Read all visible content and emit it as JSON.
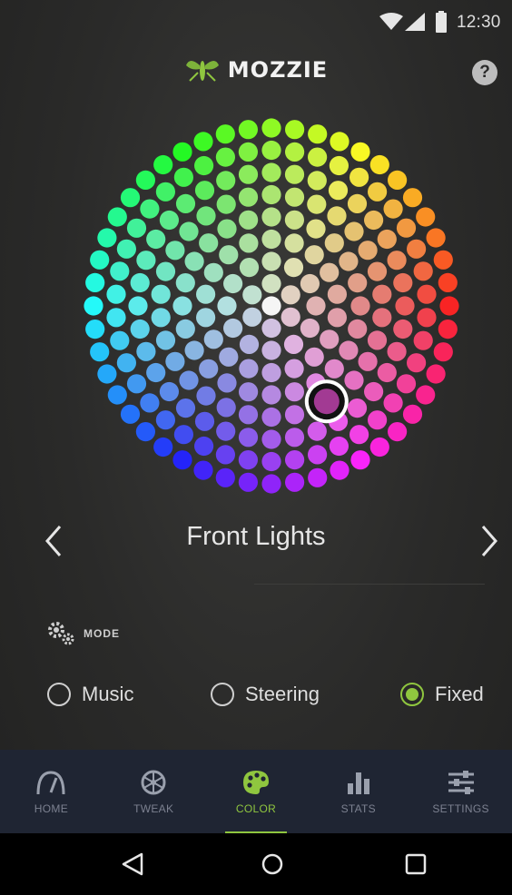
{
  "status_bar": {
    "time": "12:30",
    "icons": [
      "wifi-icon",
      "cellular-signal-icon",
      "battery-icon"
    ]
  },
  "header": {
    "brand": "MOZZIE",
    "logo_icon": "mosquito-logo-icon",
    "help_label": "?"
  },
  "color_wheel": {
    "rings": [
      1,
      6,
      12,
      18,
      24,
      30,
      36,
      42,
      48
    ],
    "selected": {
      "hue": 300,
      "saturation": 0.62
    },
    "selected_color": "#a23a93"
  },
  "light_selector": {
    "name": "Front Lights"
  },
  "mode": {
    "label": "MODE",
    "options": [
      {
        "label": "Music",
        "selected": false
      },
      {
        "label": "Steering",
        "selected": false
      },
      {
        "label": "Fixed",
        "selected": true
      }
    ]
  },
  "tabs": [
    {
      "label": "HOME",
      "icon": "speedometer-icon",
      "active": false
    },
    {
      "label": "TWEAK",
      "icon": "wheel-icon",
      "active": false
    },
    {
      "label": "COLOR",
      "icon": "palette-icon",
      "active": true
    },
    {
      "label": "STATS",
      "icon": "bar-chart-icon",
      "active": false
    },
    {
      "label": "SETTINGS",
      "icon": "sliders-icon",
      "active": false
    }
  ],
  "colors": {
    "accent": "#8fc63f",
    "tab_bar": "#1f2533",
    "inactive_tab": "#7c8190"
  },
  "system_nav": [
    "back-icon",
    "home-icon",
    "recents-icon"
  ]
}
